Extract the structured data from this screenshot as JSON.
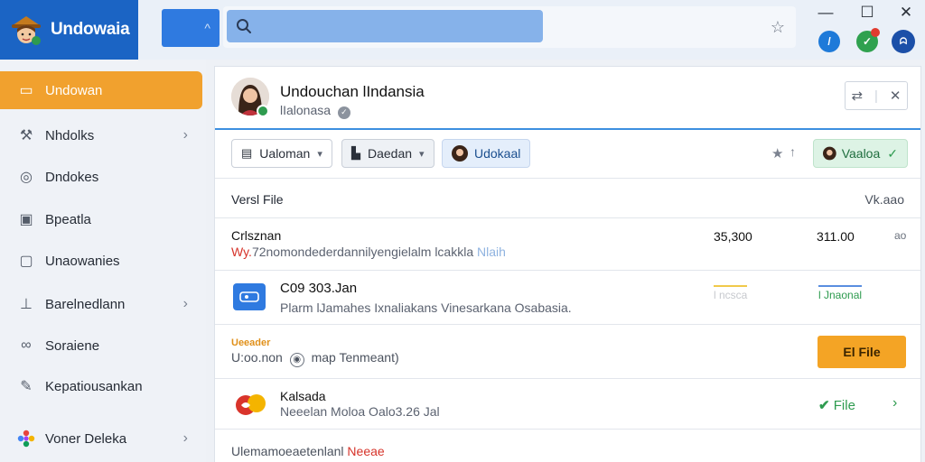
{
  "app": {
    "title": "Undowaia"
  },
  "search": {
    "placeholder": ""
  },
  "window_controls": {
    "minimize": "—",
    "maximize": "☐",
    "close": "✕"
  },
  "sidebar": {
    "items": [
      {
        "label": "Undowan",
        "icon": "inbox-icon",
        "active": true,
        "chevron": false
      },
      {
        "label": "Nhdolks",
        "icon": "hammer-icon",
        "chevron": true
      },
      {
        "label": "Dndokes",
        "icon": "target-icon",
        "chevron": false
      },
      {
        "label": "Bpeatla",
        "icon": "page-icon",
        "chevron": false
      },
      {
        "label": "Unaowanies",
        "icon": "monitor-icon",
        "chevron": false
      },
      {
        "label": "Barelnedlann",
        "icon": "stamp-icon",
        "chevron": true
      },
      {
        "label": "Soraiene",
        "icon": "link-icon",
        "chevron": false
      },
      {
        "label": "Kepatiousankan",
        "icon": "pen-icon",
        "chevron": false
      },
      {
        "label": "Voner Deleka",
        "icon": "apps-icon",
        "chevron": true
      }
    ]
  },
  "header": {
    "name": "Undouchan lIndansia",
    "subtitle": "lIalonasa",
    "badge": "✓"
  },
  "toolbar": {
    "btn1": "Ualoman",
    "btn2": "Daedan",
    "btn3": "Udokaal",
    "btn4": "Vaaloa"
  },
  "table": {
    "col_left": "Versl File",
    "col_right": "Vk.aao"
  },
  "rows": {
    "r1": {
      "title": "Crlsznan",
      "prefix": "Wy.",
      "desc": "72nomondederdannilyengielalm lcakkla",
      "tag": "Nlaih",
      "v1": "35,300",
      "v2": "311.00",
      "v3": "ao"
    },
    "r2": {
      "title": "C09 303.Jan",
      "desc": "Plarm lJamahes Ixnaliakans Vinesarkana Osabasia.",
      "v1": "l ncsca",
      "v2": "l Jnaonal"
    },
    "r3": {
      "label": "Ueeader",
      "desc": "U:oo.non",
      "hint": "map Tenmeant)",
      "btn": "El File"
    },
    "r4": {
      "title": "Kalsada",
      "desc": "Neeelan Moloa Oalo3.26 Jal",
      "status": "File",
      "chev": "›"
    },
    "r5": {
      "desc": "Ulemamoeaetenlanl",
      "tag": "Neeae"
    }
  },
  "colors": {
    "brand": "#1b64c4",
    "accent": "#f1a12e",
    "link": "#3d8fe0",
    "success": "#2e9b4f"
  }
}
